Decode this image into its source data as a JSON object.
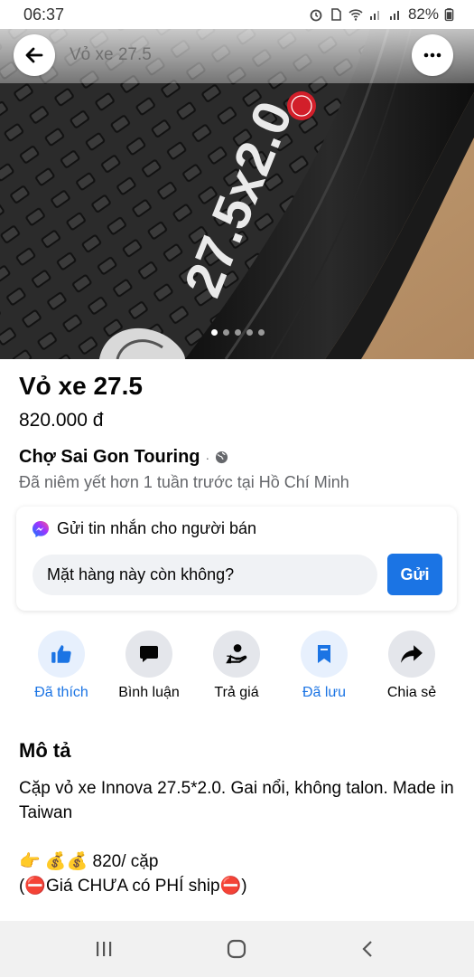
{
  "status_bar": {
    "time": "06:37",
    "battery": "82%",
    "icons": [
      "alarm-icon",
      "sim-icon",
      "wifi-icon",
      "signal-icon",
      "signal-icon",
      "battery-icon"
    ]
  },
  "hero": {
    "title": "Vỏ xe 27.5",
    "photo_count": 5,
    "active_photo": 1
  },
  "product": {
    "title": "Vỏ xe 27.5",
    "price": "820.000 đ"
  },
  "seller": {
    "name": "Chợ Sai Gon Touring",
    "separator": "·",
    "listed": "Đã niêm yết hơn 1 tuần trước tại Hồ Chí Minh"
  },
  "message": {
    "heading": "Gửi tin nhắn cho người bán",
    "input_value": "Mặt hàng này còn không?",
    "send_label": "Gửi"
  },
  "actions": [
    {
      "label": "Đã thích",
      "icon": "like-icon",
      "active": true
    },
    {
      "label": "Bình luận",
      "icon": "comment-icon",
      "active": false
    },
    {
      "label": "Trả giá",
      "icon": "offer-icon",
      "active": false
    },
    {
      "label": "Đã lưu",
      "icon": "bookmark-icon",
      "active": true
    },
    {
      "label": "Chia sẻ",
      "icon": "share-icon",
      "active": false
    }
  ],
  "description": {
    "title": "Mô tả",
    "text": "Cặp vỏ xe Innova 27.5*2.0. Gai nổi, không talon. Made in Taiwan\n\n👉 💰💰 820/ cặp\n(⛔Giá CHƯA có PHÍ ship⛔)"
  },
  "colors": {
    "accent": "#1b74e4",
    "secondary_text": "#65676b",
    "button_bg": "#e4e6eb"
  }
}
